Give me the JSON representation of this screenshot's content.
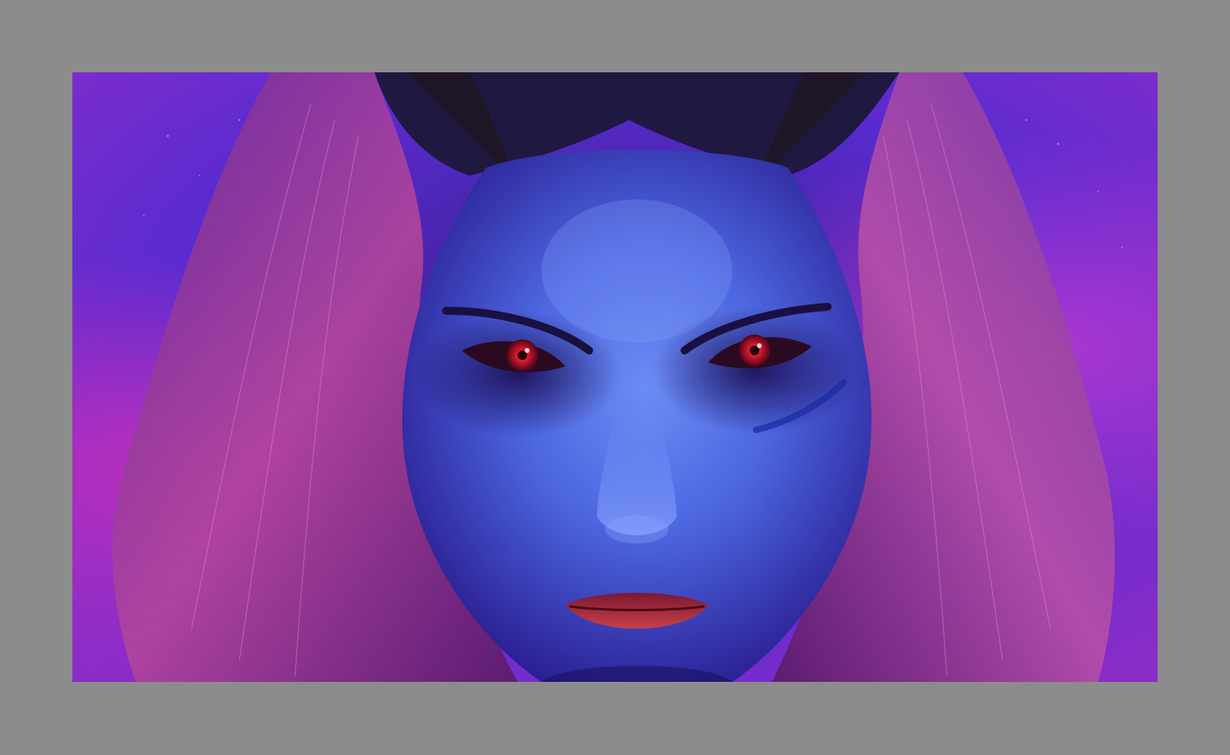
{
  "frame": {
    "border_color": "#8c8c8c"
  },
  "artwork": {
    "palette": {
      "background_violet": "#5a2bd0",
      "background_magenta": "#b02ab0",
      "skin_blue": "#4f6fe6",
      "skin_shadow": "#26188a",
      "hair_pink": "#b0459c",
      "eyes_red": "#e01830",
      "lips_red": "#a3243a",
      "horn_dark": "#1e1626"
    }
  }
}
